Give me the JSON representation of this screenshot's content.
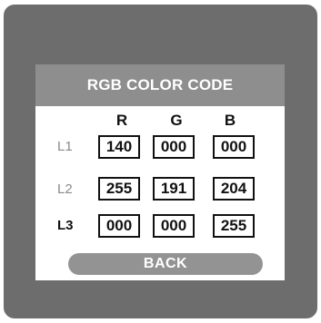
{
  "title": "RGB COLOR CODE",
  "columns": [
    "R",
    "G",
    "B"
  ],
  "rows": [
    {
      "label": "L1",
      "values": [
        "140",
        "000",
        "000"
      ]
    },
    {
      "label": "L2",
      "values": [
        "255",
        "191",
        "204"
      ]
    },
    {
      "label": "L3",
      "values": [
        "000",
        "000",
        "255"
      ]
    }
  ],
  "back_label": "BACK",
  "colors": {
    "frame": "#6d6d6d",
    "title_bar": "#8e8e8e",
    "button": "#939393"
  }
}
